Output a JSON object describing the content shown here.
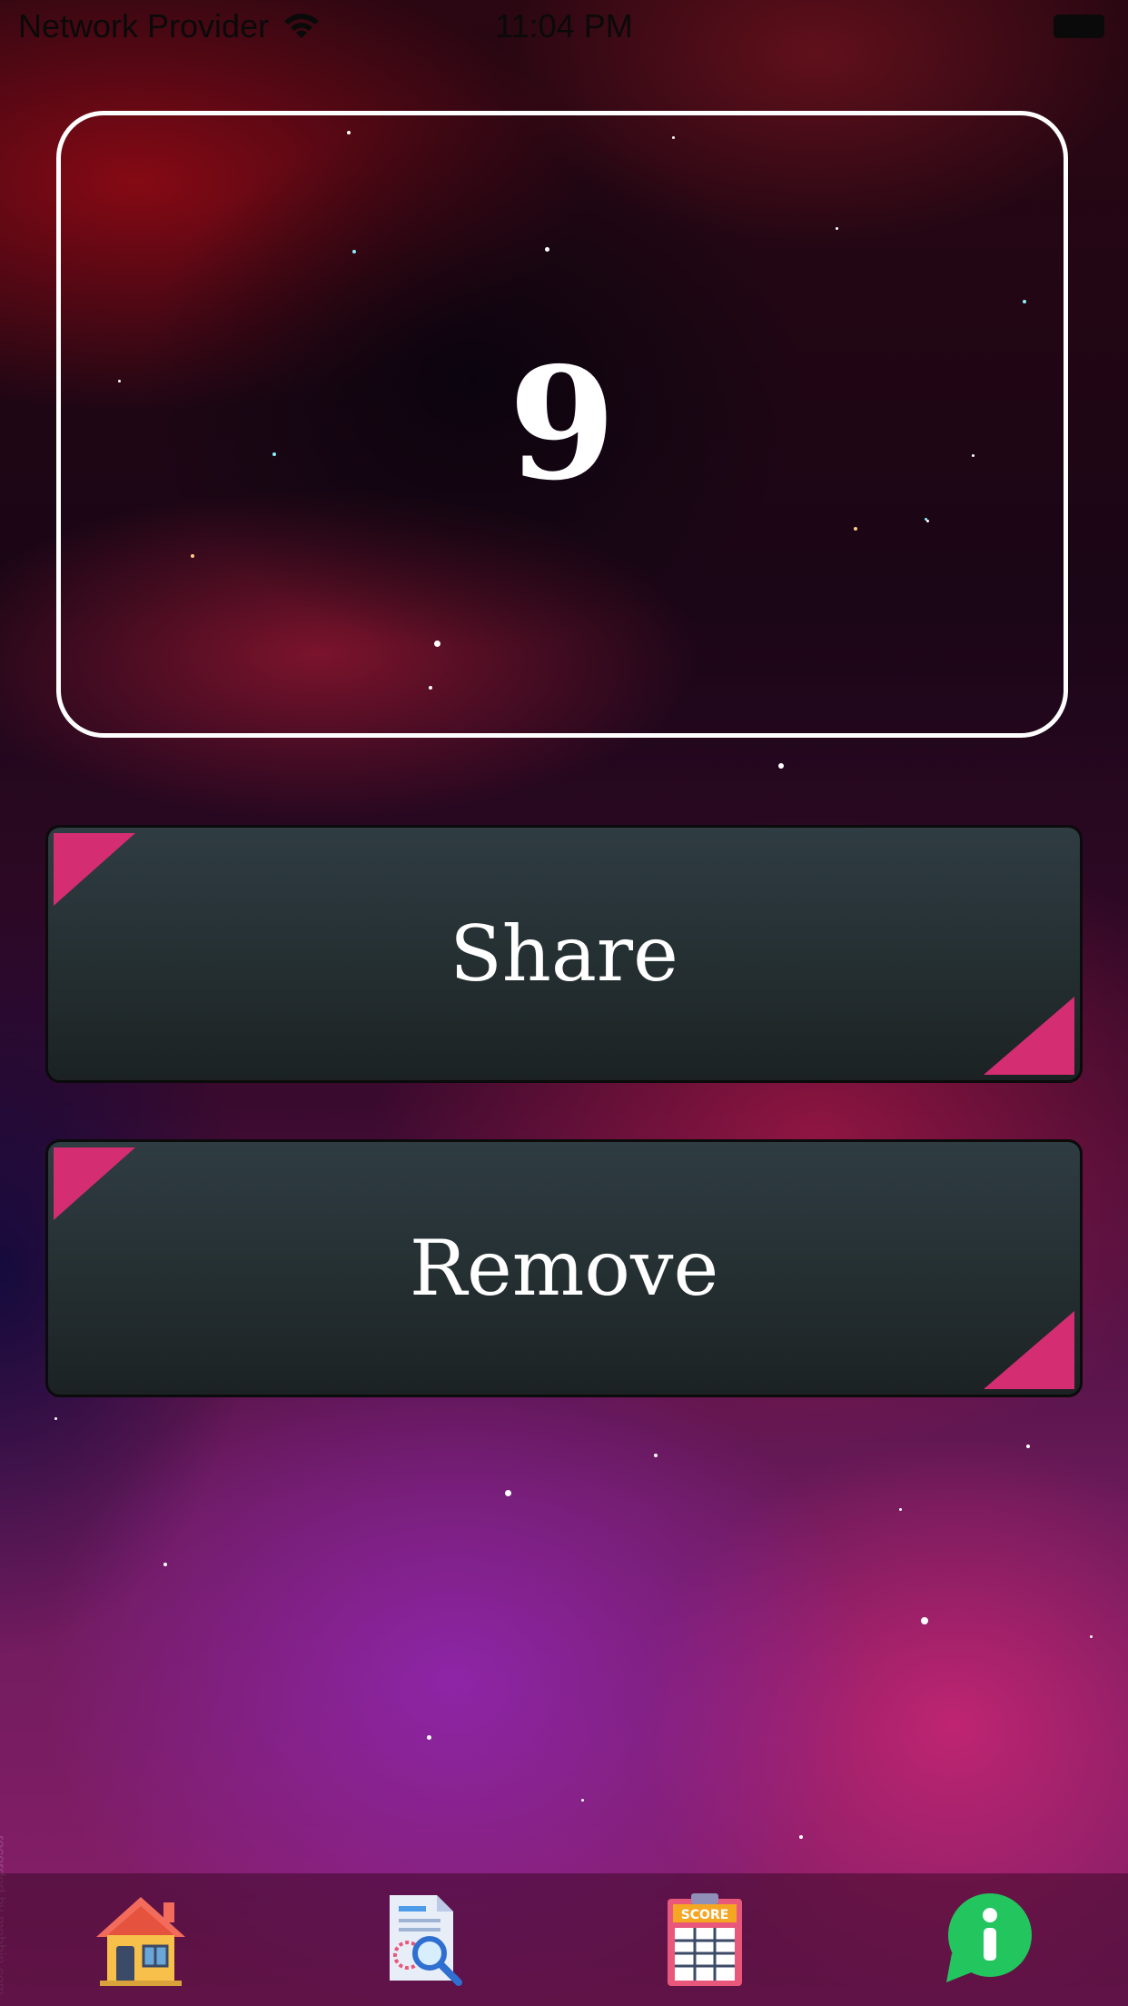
{
  "status_bar": {
    "carrier": "Network Provider",
    "time": "11:04 PM"
  },
  "counter": {
    "value": "9"
  },
  "buttons": {
    "share_label": "Share",
    "remove_label": "Remove"
  },
  "tab_bar": {
    "items": [
      {
        "icon": "home-icon"
      },
      {
        "icon": "document-search-icon"
      },
      {
        "icon": "scoreboard-icon"
      },
      {
        "icon": "info-icon"
      }
    ]
  },
  "watermark": "recorded by mobbin.com",
  "colors": {
    "accent": "#d42d72",
    "button_bg": "#253033",
    "counter_border": "#ffffff",
    "info_green": "#22c55e"
  }
}
